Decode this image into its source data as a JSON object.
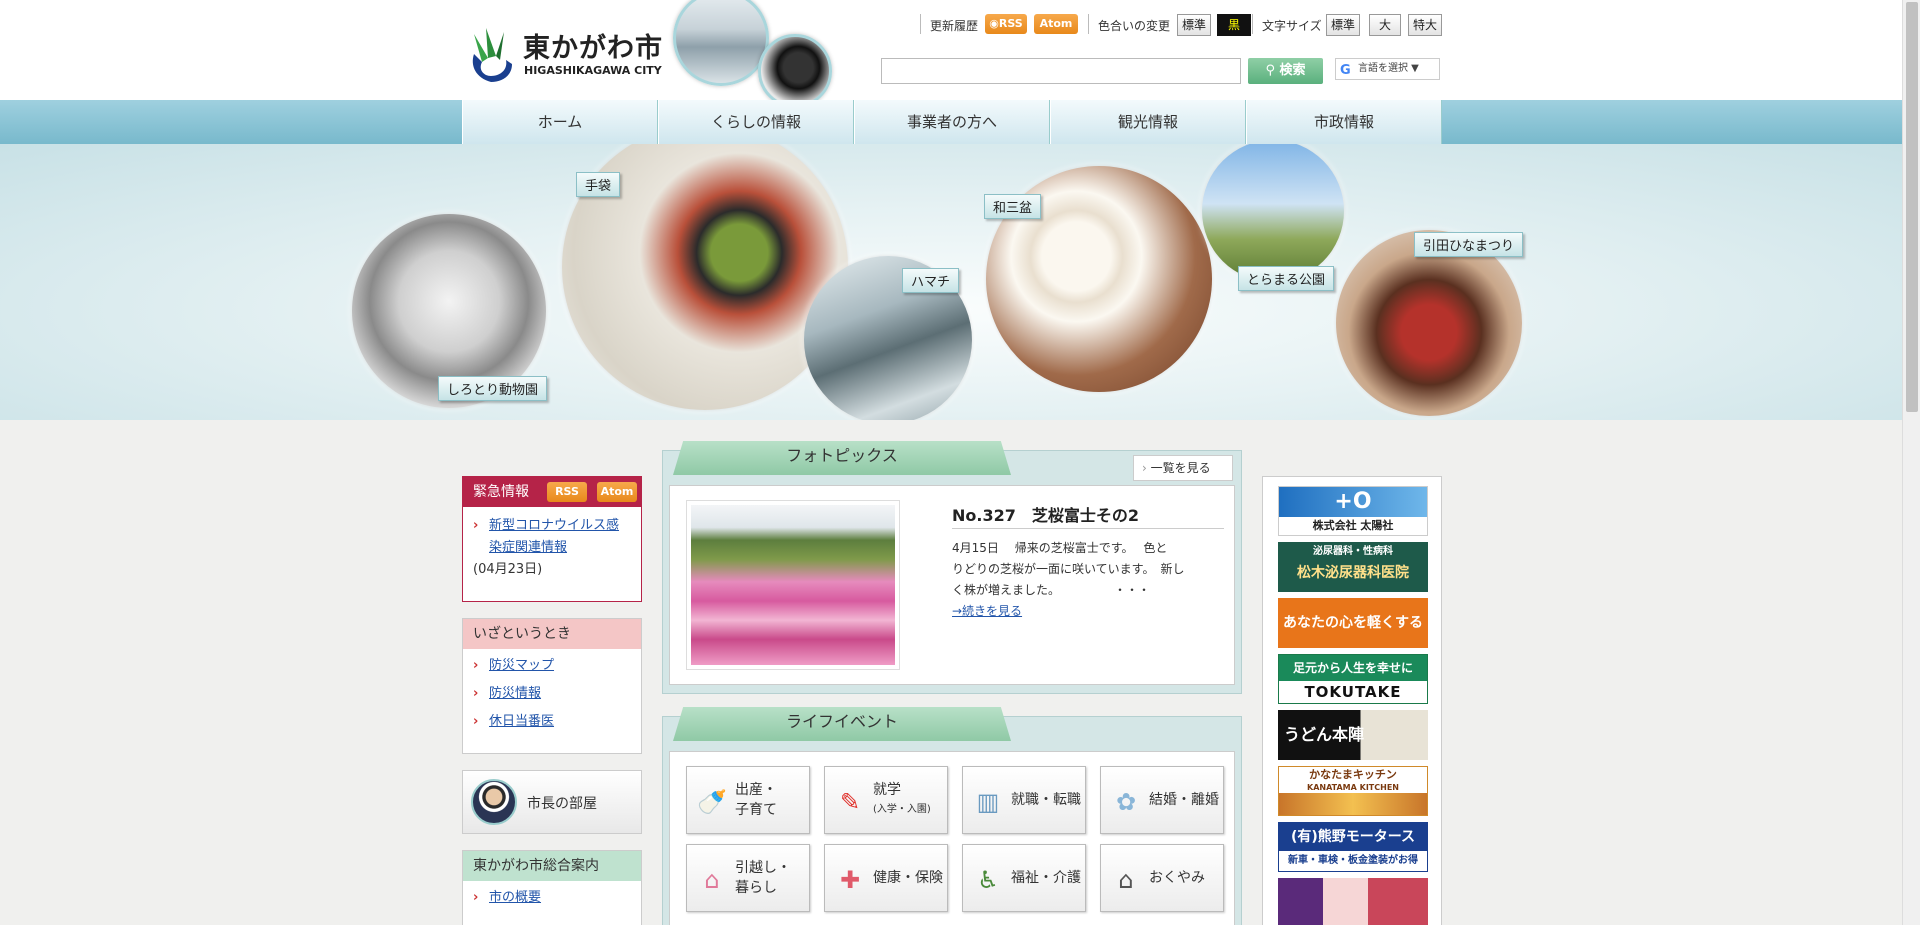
{
  "site": {
    "name_jp": "東かがわ市",
    "name_en": "HIGASHIKAGAWA CITY"
  },
  "toolbar": {
    "update_history": "更新履歴",
    "rss": "RSS",
    "atom": "Atom",
    "color_change": "色合いの変更",
    "color_standard": "標準",
    "color_black": "黒",
    "font_size": "文字サイズ",
    "font_standard": "標準",
    "font_large": "大",
    "font_xlarge": "特大",
    "search_button": "検索",
    "search_placeholder": "",
    "lang_select": "言語を選択 ▼"
  },
  "nav": {
    "items": [
      "ホーム",
      "くらしの情報",
      "事業者の方へ",
      "観光情報",
      "市政情報"
    ]
  },
  "hero": {
    "labels": {
      "glove": "手袋",
      "sanbon": "和三盆",
      "hamachi": "ハマチ",
      "zoo": "しろとり動物園",
      "park": "とらまる公園",
      "hina": "引田ひなまつり"
    }
  },
  "emergency": {
    "title": "緊急情報",
    "rss": "RSS",
    "atom": "Atom",
    "item_line1": "新型コロナウイルス感",
    "item_line2": "染症関連情報",
    "date": "(04月23日)"
  },
  "disaster": {
    "title": "いざというとき",
    "items": [
      "防災マップ",
      "防災情報",
      "休日当番医"
    ]
  },
  "mayor": {
    "label": "市長の部屋"
  },
  "guide": {
    "title": "東かがわ市総合案内",
    "items": [
      "市の概要"
    ]
  },
  "photo": {
    "tab": "フォトピックス",
    "list_link": "一覧を見る",
    "title": "No.327　芝桜富士その2",
    "body_line1": "4月15日　 帰来の芝桜富士です。　 色と",
    "body_line2": "りどりの芝桜が一面に咲いています。　新し",
    "body_line3": "く株が増えました。　　　　　・・・",
    "more": "→続きを見る"
  },
  "life": {
    "tab": "ライフイベント",
    "buttons": [
      {
        "l1": "出産・",
        "l2": "子育て",
        "icon": "baby-bottle-icon"
      },
      {
        "l1": "就学",
        "l2": "(入学・入園)",
        "icon": "school-icon"
      },
      {
        "l1": "就職・転職",
        "l2": "",
        "icon": "building-icon"
      },
      {
        "l1": "結婚・離婚",
        "l2": "",
        "icon": "wedding-icon"
      },
      {
        "l1": "引越し・",
        "l2": "暮らし",
        "icon": "house-icon"
      },
      {
        "l1": "健康・保険",
        "l2": "",
        "icon": "first-aid-icon"
      },
      {
        "l1": "福祉・介護",
        "l2": "",
        "icon": "wheelchair-icon"
      },
      {
        "l1": "おくやみ",
        "l2": "",
        "icon": "house-outline-icon"
      }
    ]
  },
  "ads": {
    "ad1_main": "株式会社 太陽社",
    "ad2_top": "泌尿器科・性病科",
    "ad2_main": "松木泌尿器科医院",
    "ad3": "あなたの心を軽くする",
    "ad4_top": "足元から人生を幸せに",
    "ad4_main": "TOKUTAKE",
    "ad5": "うどん本陣",
    "ad6_top": "かなたまキッチン",
    "ad6_sub": "KANATAMA KITCHEN",
    "ad7_main": "(有)熊野モータース",
    "ad7_sub": "新車・車検・板金塗装がお得"
  },
  "colors": {
    "accent": "#78b9cc",
    "emergency": "#b52348",
    "green": "#8fc9a6"
  }
}
